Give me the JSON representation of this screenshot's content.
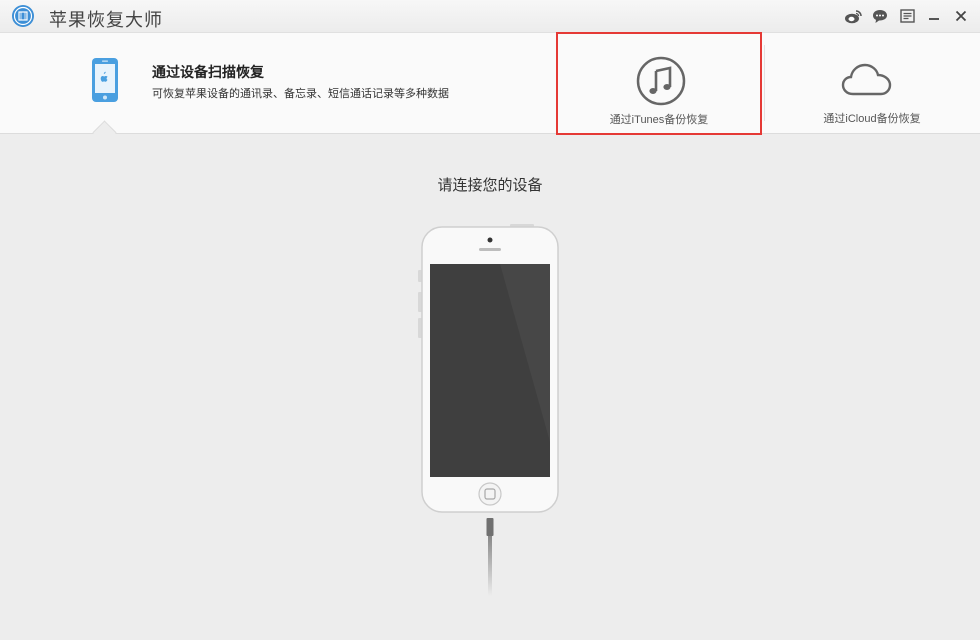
{
  "window": {
    "title": "苹果恢复大师"
  },
  "titlebar_icons": [
    "weibo-icon",
    "chat-icon",
    "feedback-icon",
    "minimize-icon",
    "close-icon"
  ],
  "modes": {
    "scan": {
      "title": "通过设备扫描恢复",
      "description": "可恢复苹果设备的通讯录、备忘录、短信通话记录等多种数据"
    },
    "itunes": {
      "label": "通过iTunes备份恢复"
    },
    "icloud": {
      "label": "通过iCloud备份恢复"
    }
  },
  "main": {
    "prompt": "请连接您的设备"
  },
  "colors": {
    "accent": "#4a9fe0",
    "highlight_border": "#e53935",
    "background": "#ededed"
  }
}
